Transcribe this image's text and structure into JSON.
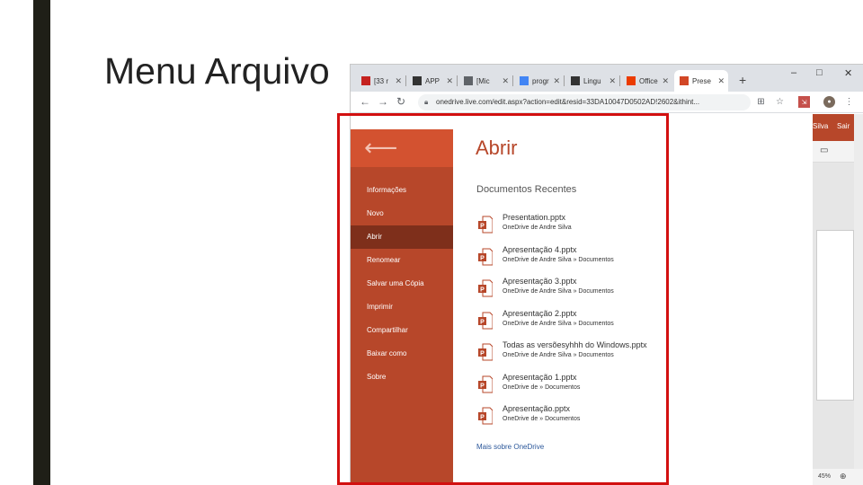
{
  "slide": {
    "title": "Menu Arquivo"
  },
  "browser": {
    "tabs": [
      {
        "label": "[33 r",
        "icon": "mail-icon",
        "color": "#c5221f",
        "active": false
      },
      {
        "label": "APP",
        "icon": "app-icon",
        "color": "#333333",
        "active": false
      },
      {
        "label": "[Mic",
        "icon": "globe-icon",
        "color": "#5f6368",
        "active": false
      },
      {
        "label": "progr",
        "icon": "google-icon",
        "color": "#4285f4",
        "active": false
      },
      {
        "label": "Lingu",
        "icon": "wikipedia-icon",
        "color": "#333333",
        "active": false
      },
      {
        "label": "Office",
        "icon": "office-icon",
        "color": "#eb3c00",
        "active": false
      },
      {
        "label": "Prese",
        "icon": "powerpoint-icon",
        "color": "#d24726",
        "active": true
      }
    ],
    "new_tab": "+",
    "window_controls": {
      "minimize": "–",
      "maximize": "□",
      "close": "✕"
    },
    "url": "onedrive.live.com/edit.aspx?action=edit&resid=33DA10047D0502AD!2602&ithint..."
  },
  "office": {
    "user_name": "Silva",
    "signout_label": "Sair",
    "zoom": "45%"
  },
  "backstage": {
    "back_icon": "back-arrow-icon",
    "menu": [
      {
        "label": "Informações",
        "active": false
      },
      {
        "label": "Novo",
        "active": false
      },
      {
        "label": "Abrir",
        "active": true
      },
      {
        "label": "Renomear",
        "active": false
      },
      {
        "label": "Salvar uma Cópia",
        "active": false
      },
      {
        "label": "Imprimir",
        "active": false
      },
      {
        "label": "Compartilhar",
        "active": false
      },
      {
        "label": "Baixar como",
        "active": false
      },
      {
        "label": "Sobre",
        "active": false
      }
    ],
    "title": "Abrir",
    "subtitle": "Documentos Recentes",
    "documents": [
      {
        "name": "Presentation.pptx",
        "path": "OneDrive de Andre Silva"
      },
      {
        "name": "Apresentação 4.pptx",
        "path": "OneDrive de Andre Silva » Documentos"
      },
      {
        "name": "Apresentação 3.pptx",
        "path": "OneDrive de Andre Silva » Documentos"
      },
      {
        "name": "Apresentação 2.pptx",
        "path": "OneDrive de Andre Silva » Documentos"
      },
      {
        "name": "Todas as versõesyhhh do Windows.pptx",
        "path": "OneDrive de Andre Silva » Documentos"
      },
      {
        "name": "Apresentação 1.pptx",
        "path": "OneDrive de » Documentos"
      },
      {
        "name": "Apresentação.pptx",
        "path": "OneDrive de » Documentos"
      }
    ],
    "more_link": "Mais sobre OneDrive"
  },
  "colors": {
    "accent": "#b7472a",
    "accent_light": "#d35230",
    "accent_active": "#7e2f1b",
    "highlight": "#d21010"
  }
}
